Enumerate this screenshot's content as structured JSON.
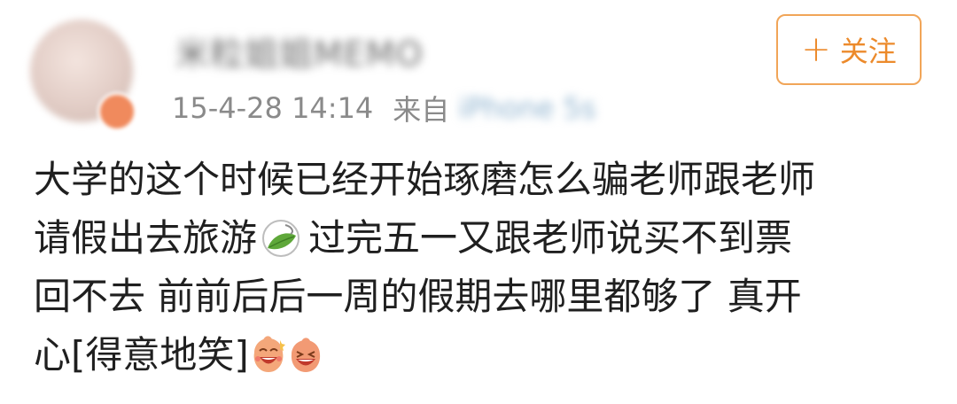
{
  "post": {
    "username": "米粒姐姐MEMO",
    "time": "15-4-28 14:14",
    "source_prefix": "来自",
    "source_device": "iPhone 5s",
    "follow_button": {
      "icon": "plus-icon",
      "plus": "+",
      "label": "关注"
    },
    "content": {
      "line1": "大学的这个时候已经开始琢磨怎么骗老师跟老师",
      "line2_a": "请假出去旅游",
      "emoji_leaf": "leaf-emoji",
      "line2_b": "过完五一又跟老师说买不到票",
      "line3": "回不去 前前后后一周的假期去哪里都够了 真开",
      "line4": "心[得意地笑]",
      "emoji_faces": [
        "laughing-face-emoji",
        "laughing-face-emoji"
      ]
    },
    "colors": {
      "accent": "#ec8a2b",
      "button_border": "#f1a558",
      "meta_text": "#8a8a8a",
      "body_text": "#1f1f1f"
    }
  }
}
